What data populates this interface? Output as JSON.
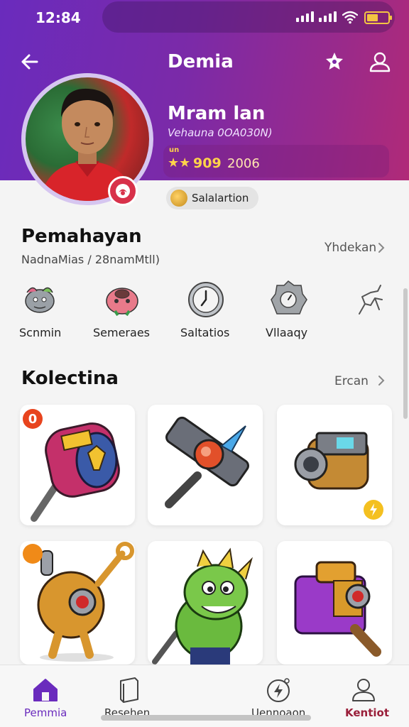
{
  "status_bar": {
    "time": "12:84",
    "battery_level": 0.55,
    "battery_color": "#f4c542"
  },
  "header": {
    "title": "Demia",
    "back_icon": "arrow-left-icon",
    "favorite_icon": "star-icon",
    "account_icon": "user-icon",
    "gradient": [
      "#6a2bbd",
      "#b02a78"
    ]
  },
  "profile": {
    "name": "Mram lan",
    "subtitle": "Vehauna 0OA030N)",
    "stats_label": "un",
    "stars": "★★",
    "score": "909",
    "year": "2006",
    "tag": "Salalartion"
  },
  "section_main": {
    "title": "Pemahayan",
    "subtitle": "NadnaMias / 28namMtll)",
    "see_all": "Yhdekan",
    "categories": [
      {
        "label": "Scnmin",
        "icon": "creature-icon"
      },
      {
        "label": "Semeraes",
        "icon": "pig-creature-icon"
      },
      {
        "label": "Saltatios",
        "icon": "clock-icon"
      },
      {
        "label": "Vllaaqy",
        "icon": "gear-badge-icon"
      },
      {
        "label": "",
        "icon": "runner-icon"
      }
    ]
  },
  "section_collection": {
    "title": "Kolectina",
    "see_all": "Ercan",
    "items": [
      {
        "name": "drum-hammer-item",
        "badge": "0",
        "badge_color": "#e8441e"
      },
      {
        "name": "crystal-hammer-item",
        "badge": "",
        "badge_color": ""
      },
      {
        "name": "cannon-barrel-item",
        "badge": "",
        "badge_color": "#f4c020"
      },
      {
        "name": "robot-scepter-item",
        "badge": "",
        "badge_color": "#f08a18"
      },
      {
        "name": "green-dragon-item",
        "badge": "",
        "badge_color": ""
      },
      {
        "name": "toolbox-hammer-item",
        "badge": "",
        "badge_color": ""
      }
    ]
  },
  "bottom_nav": {
    "active_color": "#6a2bbd",
    "accent_color": "#9a1f3a",
    "items": [
      {
        "label": "Pemmia",
        "icon": "home-icon",
        "active": true
      },
      {
        "label": "Resehen",
        "icon": "book-icon",
        "active": false
      },
      {
        "label": "Uennoaon",
        "icon": "lightning-circle-icon",
        "active": false
      },
      {
        "label": "Kentiot",
        "icon": "profile-icon",
        "active": false
      }
    ]
  }
}
